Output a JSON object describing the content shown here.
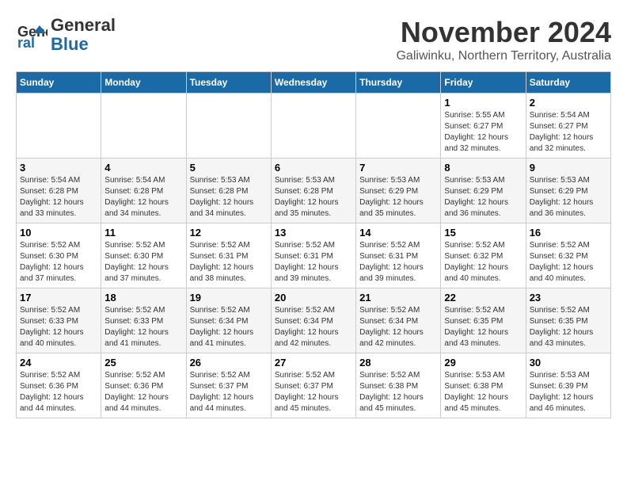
{
  "logo": {
    "line1": "General",
    "line2": "Blue"
  },
  "title": "November 2024",
  "location": "Galiwinku, Northern Territory, Australia",
  "weekdays": [
    "Sunday",
    "Monday",
    "Tuesday",
    "Wednesday",
    "Thursday",
    "Friday",
    "Saturday"
  ],
  "weeks": [
    [
      {
        "day": "",
        "info": ""
      },
      {
        "day": "",
        "info": ""
      },
      {
        "day": "",
        "info": ""
      },
      {
        "day": "",
        "info": ""
      },
      {
        "day": "",
        "info": ""
      },
      {
        "day": "1",
        "info": "Sunrise: 5:55 AM\nSunset: 6:27 PM\nDaylight: 12 hours\nand 32 minutes."
      },
      {
        "day": "2",
        "info": "Sunrise: 5:54 AM\nSunset: 6:27 PM\nDaylight: 12 hours\nand 32 minutes."
      }
    ],
    [
      {
        "day": "3",
        "info": "Sunrise: 5:54 AM\nSunset: 6:28 PM\nDaylight: 12 hours\nand 33 minutes."
      },
      {
        "day": "4",
        "info": "Sunrise: 5:54 AM\nSunset: 6:28 PM\nDaylight: 12 hours\nand 34 minutes."
      },
      {
        "day": "5",
        "info": "Sunrise: 5:53 AM\nSunset: 6:28 PM\nDaylight: 12 hours\nand 34 minutes."
      },
      {
        "day": "6",
        "info": "Sunrise: 5:53 AM\nSunset: 6:28 PM\nDaylight: 12 hours\nand 35 minutes."
      },
      {
        "day": "7",
        "info": "Sunrise: 5:53 AM\nSunset: 6:29 PM\nDaylight: 12 hours\nand 35 minutes."
      },
      {
        "day": "8",
        "info": "Sunrise: 5:53 AM\nSunset: 6:29 PM\nDaylight: 12 hours\nand 36 minutes."
      },
      {
        "day": "9",
        "info": "Sunrise: 5:53 AM\nSunset: 6:29 PM\nDaylight: 12 hours\nand 36 minutes."
      }
    ],
    [
      {
        "day": "10",
        "info": "Sunrise: 5:52 AM\nSunset: 6:30 PM\nDaylight: 12 hours\nand 37 minutes."
      },
      {
        "day": "11",
        "info": "Sunrise: 5:52 AM\nSunset: 6:30 PM\nDaylight: 12 hours\nand 37 minutes."
      },
      {
        "day": "12",
        "info": "Sunrise: 5:52 AM\nSunset: 6:31 PM\nDaylight: 12 hours\nand 38 minutes."
      },
      {
        "day": "13",
        "info": "Sunrise: 5:52 AM\nSunset: 6:31 PM\nDaylight: 12 hours\nand 39 minutes."
      },
      {
        "day": "14",
        "info": "Sunrise: 5:52 AM\nSunset: 6:31 PM\nDaylight: 12 hours\nand 39 minutes."
      },
      {
        "day": "15",
        "info": "Sunrise: 5:52 AM\nSunset: 6:32 PM\nDaylight: 12 hours\nand 40 minutes."
      },
      {
        "day": "16",
        "info": "Sunrise: 5:52 AM\nSunset: 6:32 PM\nDaylight: 12 hours\nand 40 minutes."
      }
    ],
    [
      {
        "day": "17",
        "info": "Sunrise: 5:52 AM\nSunset: 6:33 PM\nDaylight: 12 hours\nand 40 minutes."
      },
      {
        "day": "18",
        "info": "Sunrise: 5:52 AM\nSunset: 6:33 PM\nDaylight: 12 hours\nand 41 minutes."
      },
      {
        "day": "19",
        "info": "Sunrise: 5:52 AM\nSunset: 6:34 PM\nDaylight: 12 hours\nand 41 minutes."
      },
      {
        "day": "20",
        "info": "Sunrise: 5:52 AM\nSunset: 6:34 PM\nDaylight: 12 hours\nand 42 minutes."
      },
      {
        "day": "21",
        "info": "Sunrise: 5:52 AM\nSunset: 6:34 PM\nDaylight: 12 hours\nand 42 minutes."
      },
      {
        "day": "22",
        "info": "Sunrise: 5:52 AM\nSunset: 6:35 PM\nDaylight: 12 hours\nand 43 minutes."
      },
      {
        "day": "23",
        "info": "Sunrise: 5:52 AM\nSunset: 6:35 PM\nDaylight: 12 hours\nand 43 minutes."
      }
    ],
    [
      {
        "day": "24",
        "info": "Sunrise: 5:52 AM\nSunset: 6:36 PM\nDaylight: 12 hours\nand 44 minutes."
      },
      {
        "day": "25",
        "info": "Sunrise: 5:52 AM\nSunset: 6:36 PM\nDaylight: 12 hours\nand 44 minutes."
      },
      {
        "day": "26",
        "info": "Sunrise: 5:52 AM\nSunset: 6:37 PM\nDaylight: 12 hours\nand 44 minutes."
      },
      {
        "day": "27",
        "info": "Sunrise: 5:52 AM\nSunset: 6:37 PM\nDaylight: 12 hours\nand 45 minutes."
      },
      {
        "day": "28",
        "info": "Sunrise: 5:52 AM\nSunset: 6:38 PM\nDaylight: 12 hours\nand 45 minutes."
      },
      {
        "day": "29",
        "info": "Sunrise: 5:53 AM\nSunset: 6:38 PM\nDaylight: 12 hours\nand 45 minutes."
      },
      {
        "day": "30",
        "info": "Sunrise: 5:53 AM\nSunset: 6:39 PM\nDaylight: 12 hours\nand 46 minutes."
      }
    ]
  ]
}
